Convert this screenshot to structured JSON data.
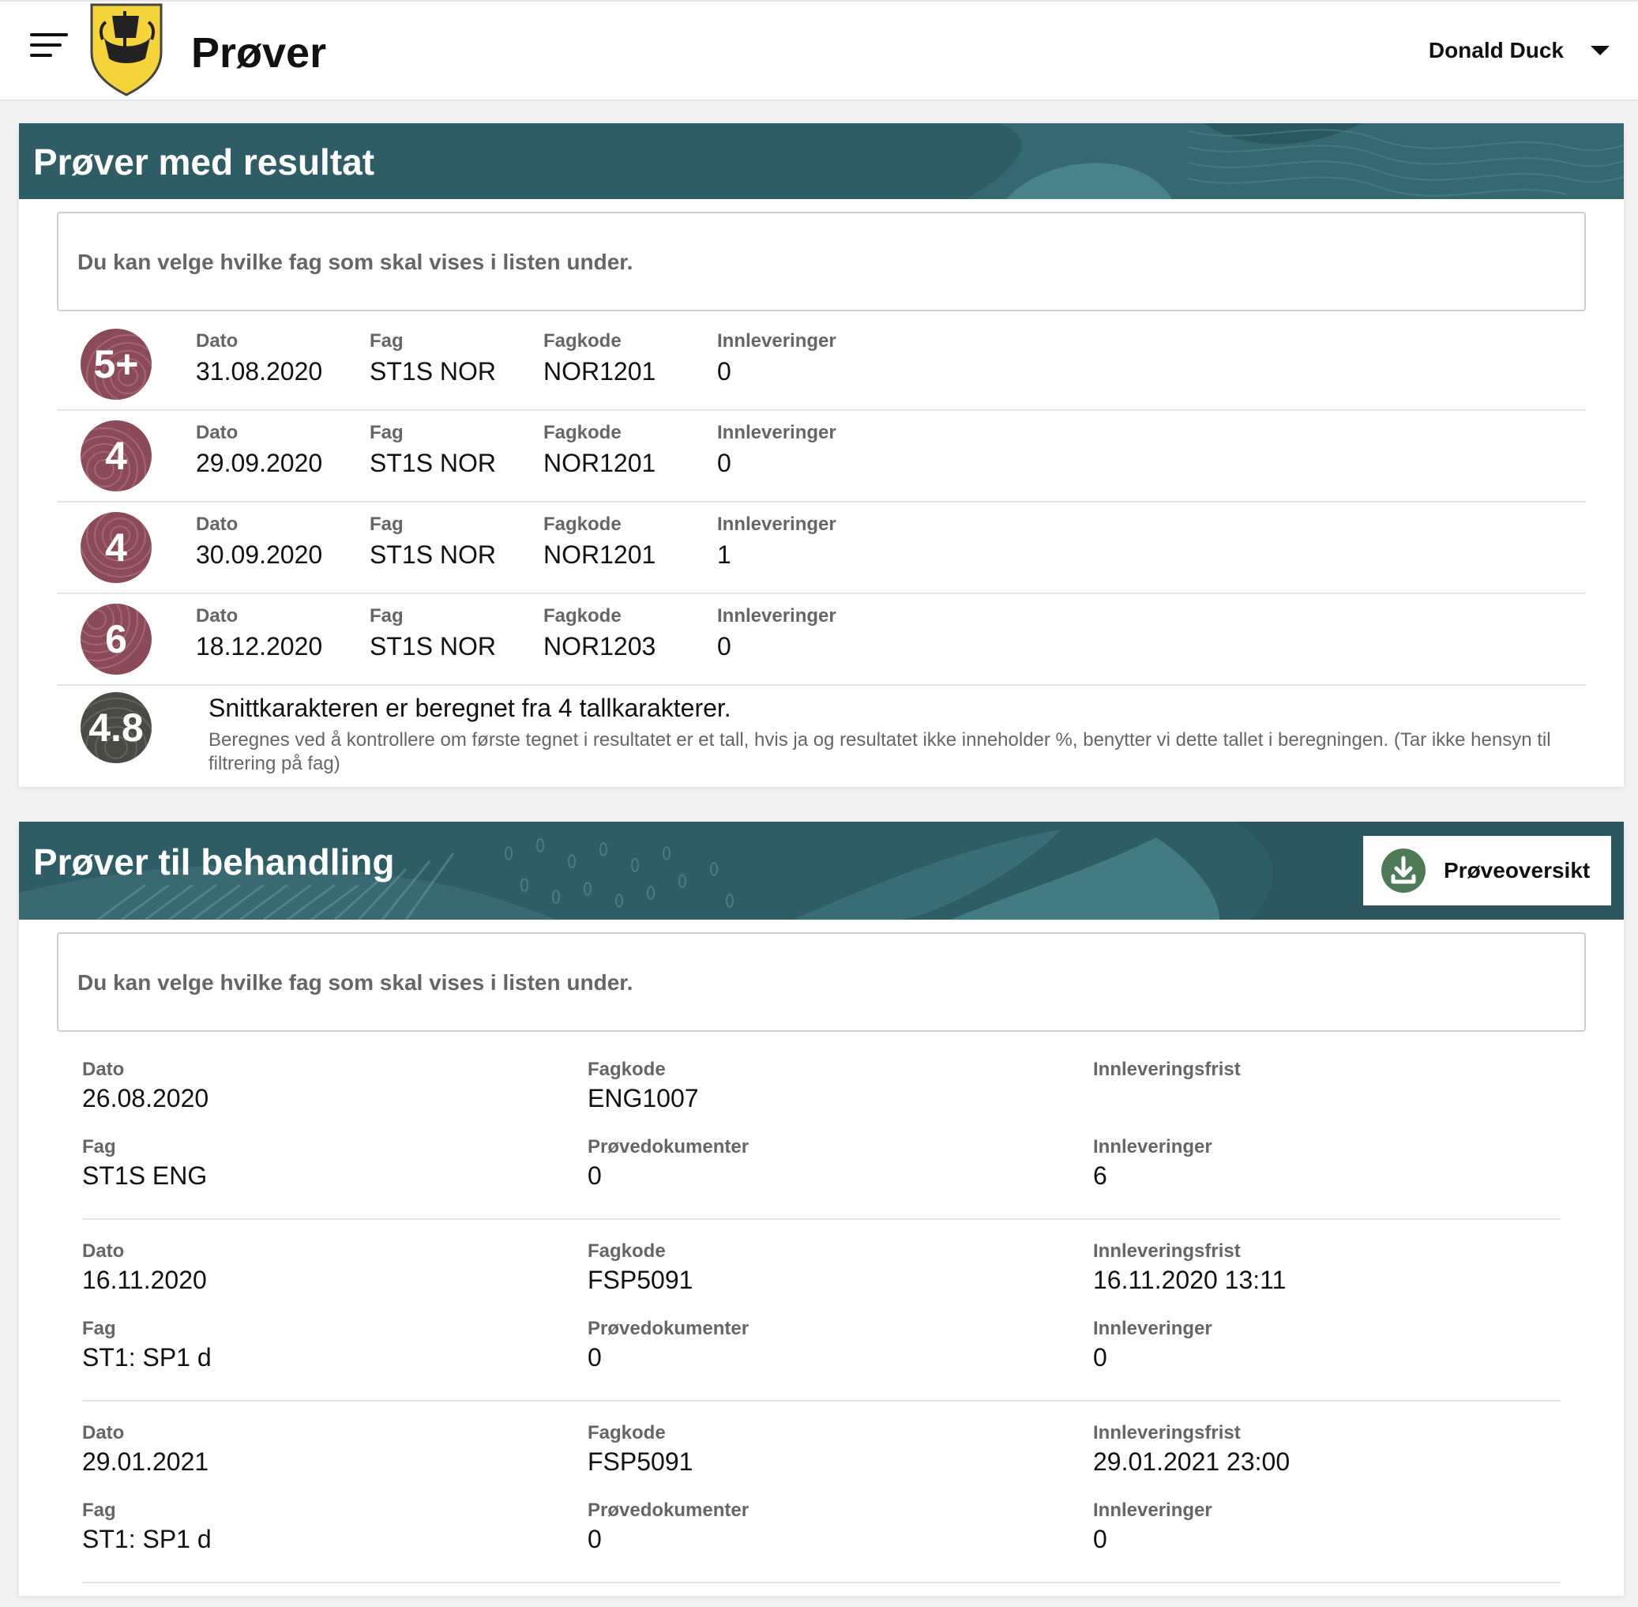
{
  "app": {
    "title": "Prøver",
    "user_name": "Donald Duck"
  },
  "colors": {
    "header_bg": "#2e5d66",
    "grade_badge": "#8a4a58",
    "avg_badge": "#4a4a44",
    "download_icon_bg": "#4f7a58"
  },
  "icons": {
    "menu": "hamburger-menu-icon",
    "logo": "county-shield-logo",
    "user_caret": "chevron-down-icon",
    "download": "download-icon"
  },
  "results_section": {
    "title": "Prøver med resultat",
    "filter_text": "Du kan velge hvilke fag som skal vises i listen under.",
    "labels": {
      "date": "Dato",
      "subject": "Fag",
      "code": "Fagkode",
      "submissions": "Innleveringer"
    },
    "rows": [
      {
        "grade": "5+",
        "date": "31.08.2020",
        "subject": "ST1S NOR",
        "code": "NOR1201",
        "submissions": "0"
      },
      {
        "grade": "4",
        "date": "29.09.2020",
        "subject": "ST1S NOR",
        "code": "NOR1201",
        "submissions": "0"
      },
      {
        "grade": "4",
        "date": "30.09.2020",
        "subject": "ST1S NOR",
        "code": "NOR1201",
        "submissions": "1"
      },
      {
        "grade": "6",
        "date": "18.12.2020",
        "subject": "ST1S NOR",
        "code": "NOR1203",
        "submissions": "0"
      }
    ],
    "average": {
      "value": "4.8",
      "title": "Snittkarakteren er beregnet fra 4 tallkarakterer.",
      "description": "Beregnes ved å kontrollere om første tegnet i resultatet er et tall, hvis ja og resultatet ikke inneholder %, benytter vi dette tallet i beregningen. (Tar ikke hensyn til filtrering på fag)"
    }
  },
  "pending_section": {
    "title": "Prøver til behandling",
    "overview_button": "Prøveoversikt",
    "filter_text": "Du kan velge hvilke fag som skal vises i listen under.",
    "labels": {
      "date": "Dato",
      "code": "Fagkode",
      "deadline": "Innleveringsfrist",
      "subject": "Fag",
      "documents": "Prøvedokumenter",
      "submissions": "Innleveringer"
    },
    "rows": [
      {
        "date": "26.08.2020",
        "code": "ENG1007",
        "deadline": "",
        "subject": "ST1S ENG",
        "documents": "0",
        "submissions": "6"
      },
      {
        "date": "16.11.2020",
        "code": "FSP5091",
        "deadline": "16.11.2020 13:11",
        "subject": "ST1: SP1 d",
        "documents": "0",
        "submissions": "0"
      },
      {
        "date": "29.01.2021",
        "code": "FSP5091",
        "deadline": "29.01.2021 23:00",
        "subject": "ST1: SP1 d",
        "documents": "0",
        "submissions": "0"
      }
    ]
  }
}
